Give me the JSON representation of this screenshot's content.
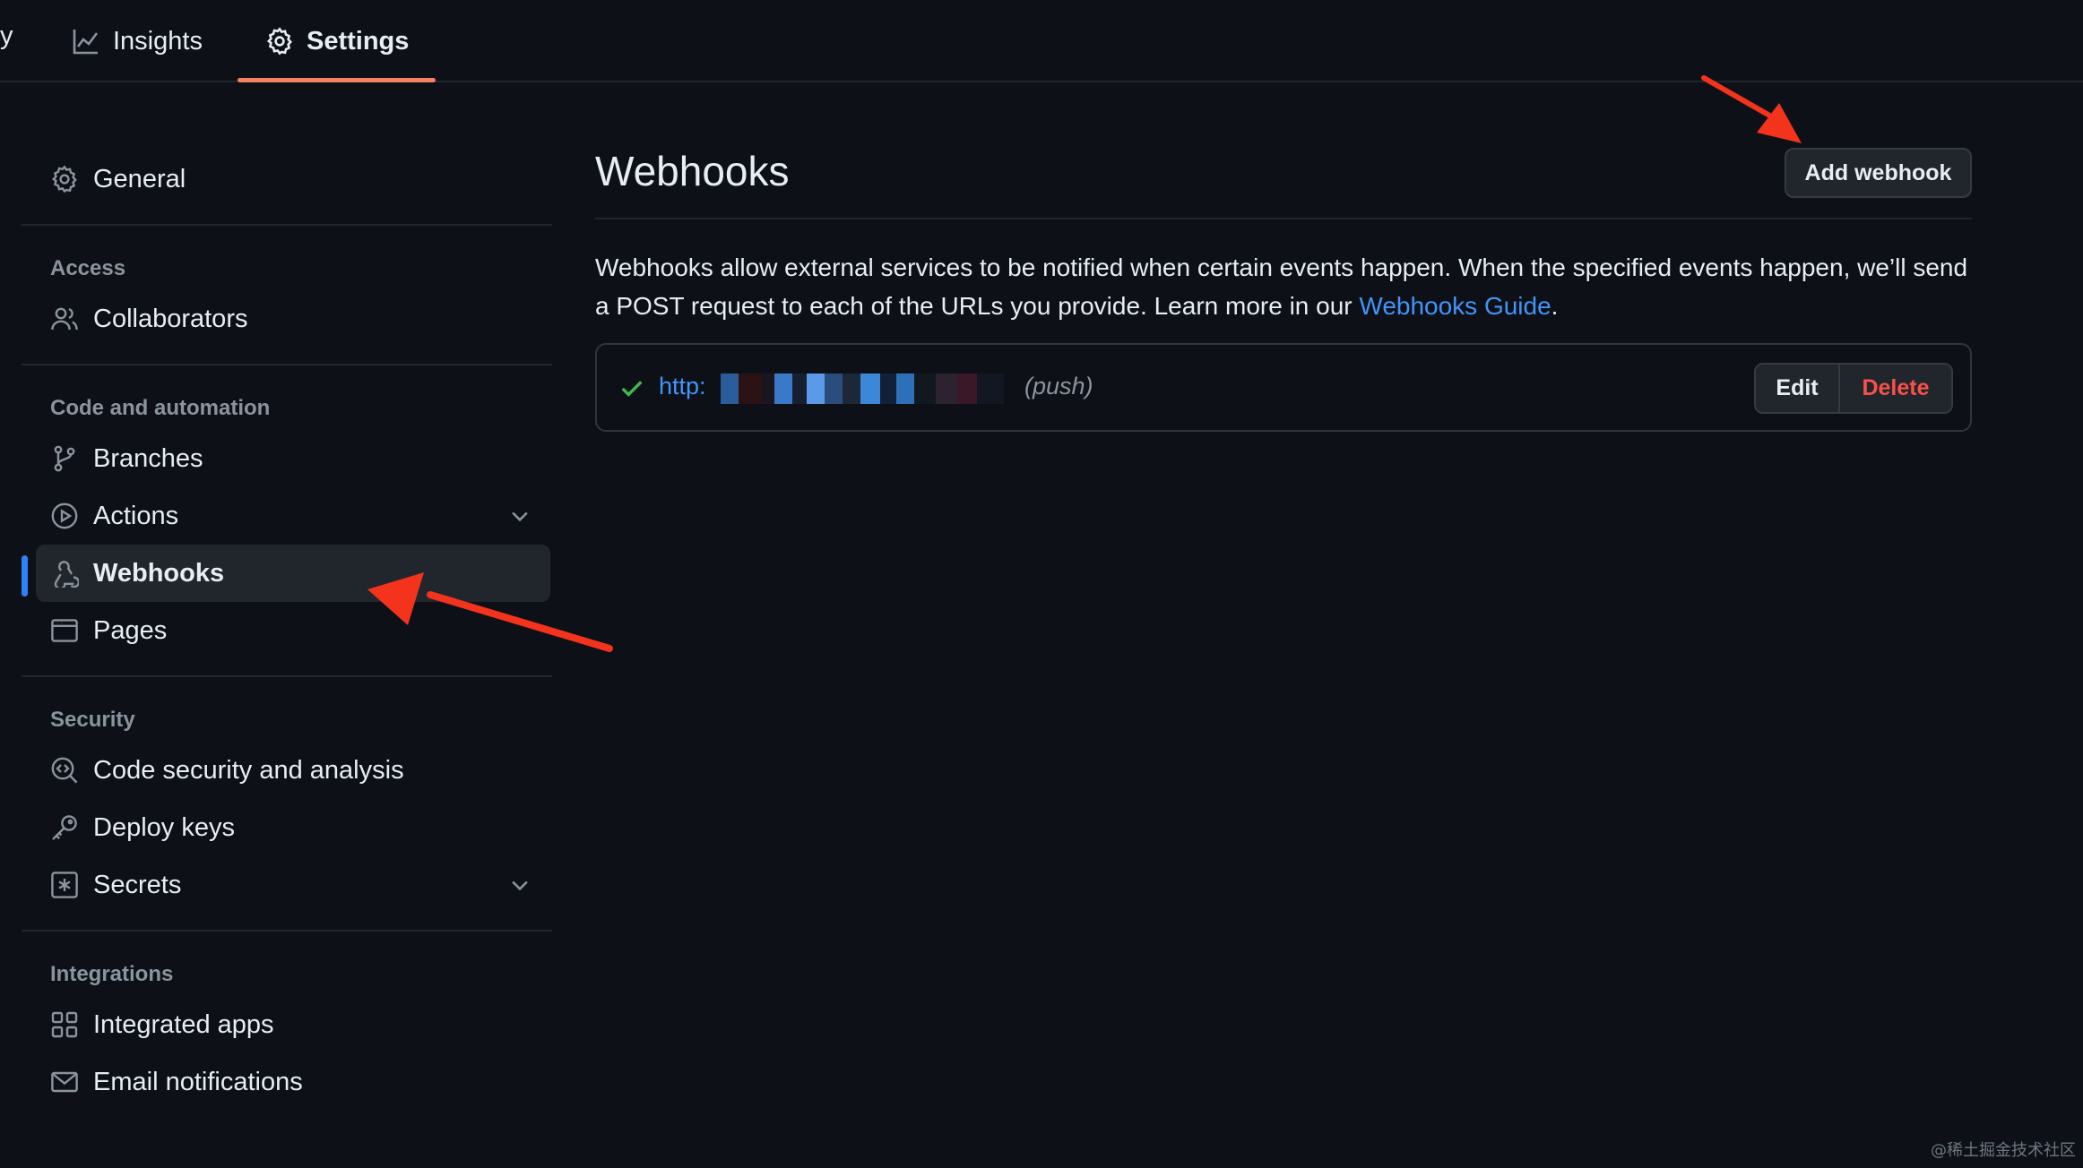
{
  "topnav": {
    "fragment": "y",
    "tabs": [
      {
        "label": "Insights",
        "icon": "graph-icon"
      },
      {
        "label": "Settings",
        "icon": "gear-icon",
        "selected": true
      }
    ]
  },
  "sidebar": {
    "general": {
      "label": "General",
      "icon": "gear-icon"
    },
    "groups": [
      {
        "title": "Access",
        "items": [
          {
            "label": "Collaborators",
            "icon": "people-icon"
          }
        ]
      },
      {
        "title": "Code and automation",
        "items": [
          {
            "label": "Branches",
            "icon": "branch-icon"
          },
          {
            "label": "Actions",
            "icon": "play-icon",
            "expandable": true
          },
          {
            "label": "Webhooks",
            "icon": "webhook-icon",
            "active": true
          },
          {
            "label": "Pages",
            "icon": "browser-icon"
          }
        ]
      },
      {
        "title": "Security",
        "items": [
          {
            "label": "Code security and analysis",
            "icon": "codescan-icon"
          },
          {
            "label": "Deploy keys",
            "icon": "key-icon"
          },
          {
            "label": "Secrets",
            "icon": "asterisk-square-icon",
            "expandable": true
          }
        ]
      },
      {
        "title": "Integrations",
        "items": [
          {
            "label": "Integrated apps",
            "icon": "apps-icon"
          },
          {
            "label": "Email notifications",
            "icon": "mail-icon"
          }
        ]
      }
    ]
  },
  "main": {
    "title": "Webhooks",
    "add_button": "Add webhook",
    "description_before": "Webhooks allow external services to be notified when certain events happen. When the specified events happen, we’ll send a POST request to each of the URLs you provide. Learn more in our ",
    "description_link": "Webhooks Guide",
    "description_after": ".",
    "webhook": {
      "status_icon": "check-icon",
      "url_visible": "http:",
      "url_redacted": true,
      "events": "(push)",
      "edit_label": "Edit",
      "delete_label": "Delete"
    }
  },
  "watermark": "@稀土掘金技术社区",
  "colors": {
    "background": "#0d1117",
    "link": "#4493f8",
    "danger": "#f85149",
    "success": "#3fb950",
    "active_indicator": "#2f81f7",
    "tab_underline": "#f78166",
    "annotation_arrow": "#f4331d"
  }
}
